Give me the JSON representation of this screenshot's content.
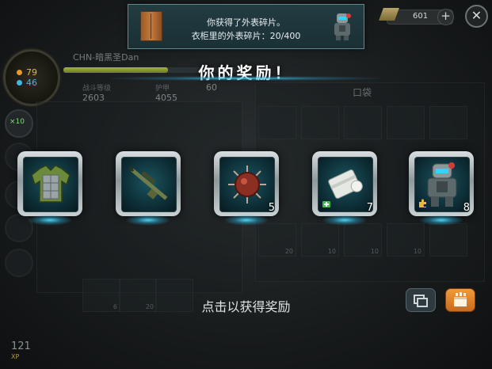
{
  "hud": {
    "resource_1": "79",
    "resource_2": "46",
    "boost": "×10"
  },
  "player": {
    "name": "CHN-暗黑圣Dan",
    "stats": [
      {
        "label": "战斗等级",
        "value": "2603"
      },
      {
        "label": "护甲",
        "value": "4055"
      },
      {
        "label": "",
        "value": "60"
      }
    ],
    "level": "121",
    "level_sub": "XP"
  },
  "inventory": {
    "title": "口袋",
    "counts": [
      "20",
      "10",
      "10",
      "10",
      "6",
      "20"
    ]
  },
  "notification": {
    "line1": "你获得了外表碎片。",
    "line2": "衣柜里的外表碎片：20/400"
  },
  "currency": {
    "value": "601"
  },
  "rewards": {
    "title": "你的奖励！",
    "items": [
      {
        "icon": "armor-jacket-icon",
        "count": ""
      },
      {
        "icon": "sniper-rifle-icon",
        "count": ""
      },
      {
        "icon": "spiked-mine-icon",
        "count": "5"
      },
      {
        "icon": "bandage-medkit-icon",
        "count": "7"
      },
      {
        "icon": "robot-costume-icon",
        "count": "8"
      }
    ]
  },
  "footer": {
    "tap_hint": "点击以获得奖励"
  },
  "colors": {
    "accent_cyan": "#46d2f0",
    "bg": "#141617",
    "orange_button": "#e8862a"
  }
}
